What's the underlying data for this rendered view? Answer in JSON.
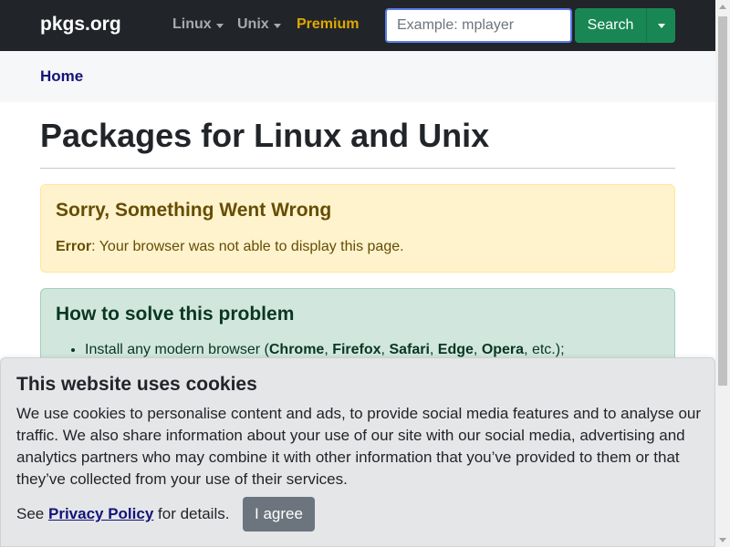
{
  "navbar": {
    "brand": "pkgs.org",
    "links": [
      "Linux",
      "Unix",
      "Premium"
    ],
    "search_placeholder": "Example: mplayer",
    "search_button": "Search",
    "colors": {
      "background": "#212529",
      "premium": "#e0a800",
      "search_button": "#198754"
    }
  },
  "breadcrumb": {
    "home": "Home"
  },
  "main": {
    "title": "Packages for Linux and Unix",
    "warning": {
      "heading": "Sorry, Something Went Wrong",
      "error_label": "Error",
      "error_text": ": Your browser was not able to display this page."
    },
    "solution": {
      "heading": "How to solve this problem",
      "item_prefix": "Install any modern browser (",
      "browsers": [
        "Chrome",
        "Firefox",
        "Safari",
        "Edge",
        "Opera"
      ],
      "item_suffix": ", etc.);"
    }
  },
  "cookie": {
    "title": "This website uses cookies",
    "text": "We use cookies to personalise content and ads, to provide social media features and to analyse our traffic. We also share information about your use of our site with our social media, advertising and analytics partners who may combine it with other information that you’ve provided to them or that they’ve collected from your use of their services.",
    "see": "See ",
    "policy_link": "Privacy Policy",
    "see_suffix": " for details.",
    "agree_button": "I agree",
    "colors": {
      "banner": "#e5e6e8",
      "agree_button": "#6c757d"
    }
  }
}
